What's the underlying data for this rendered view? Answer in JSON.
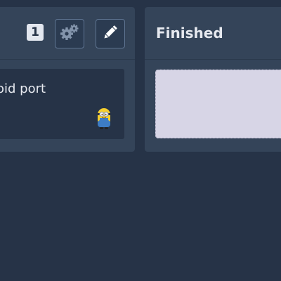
{
  "columns": [
    {
      "title": "",
      "count": "1",
      "cards": [
        {
          "title": "roid port"
        }
      ]
    },
    {
      "title": "Finished"
    }
  ],
  "icons": {
    "settings": "gears-icon",
    "edit": "pencil-icon",
    "avatar": "minion-avatar"
  },
  "colors": {
    "background": "#263347",
    "column": "#344459",
    "card": "#263347",
    "dropzone": "#d7d5e6",
    "badge": "#e3e7ef"
  }
}
